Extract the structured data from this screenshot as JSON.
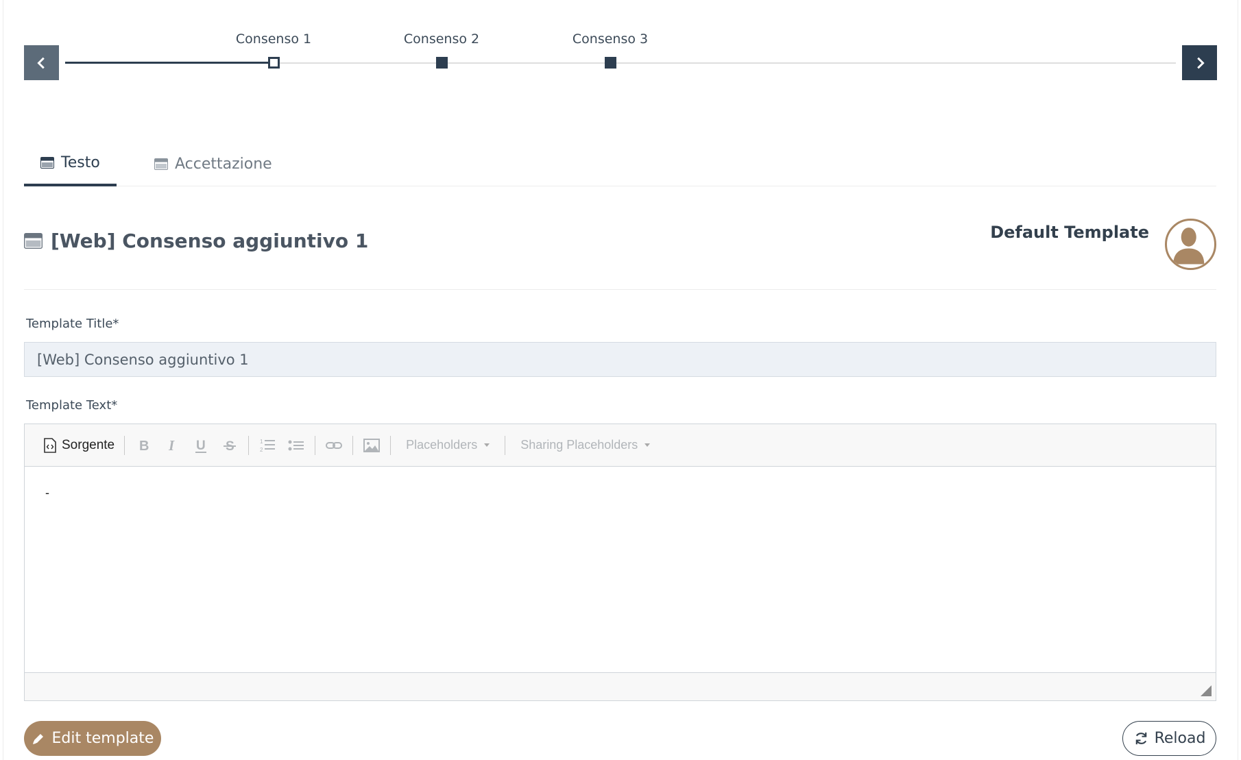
{
  "timeline": {
    "steps": [
      {
        "label": "Consenso 1",
        "state": "active"
      },
      {
        "label": "Consenso 2",
        "state": "inactive"
      },
      {
        "label": "Consenso 3",
        "state": "inactive"
      }
    ],
    "prev_icon": "chevron-left-icon",
    "next_icon": "chevron-right-icon"
  },
  "tabs": [
    {
      "label": "Testo",
      "icon": "window-icon",
      "active": true
    },
    {
      "label": "Accettazione",
      "icon": "window-icon",
      "active": false
    }
  ],
  "section": {
    "title": "[Web] Consenso aggiuntivo 1",
    "icon": "window-icon",
    "default_template": "Default Template",
    "avatar_icon": "user-silhouette-icon"
  },
  "form": {
    "title_label": "Template Title*",
    "title_value": "[Web] Consenso aggiuntivo 1",
    "text_label": "Template Text*",
    "editor": {
      "source_label": "Sorgente",
      "placeholders_label": "Placeholders",
      "sharing_placeholders_label": "Sharing Placeholders",
      "content": "-"
    }
  },
  "actions": {
    "edit_label": "Edit template",
    "edit_icon": "pencil-icon",
    "reload_label": "Reload",
    "reload_icon": "refresh-icon"
  },
  "colors": {
    "primary": "#2d3e50",
    "accent": "#a98764",
    "input_bg": "#edf1f6"
  }
}
